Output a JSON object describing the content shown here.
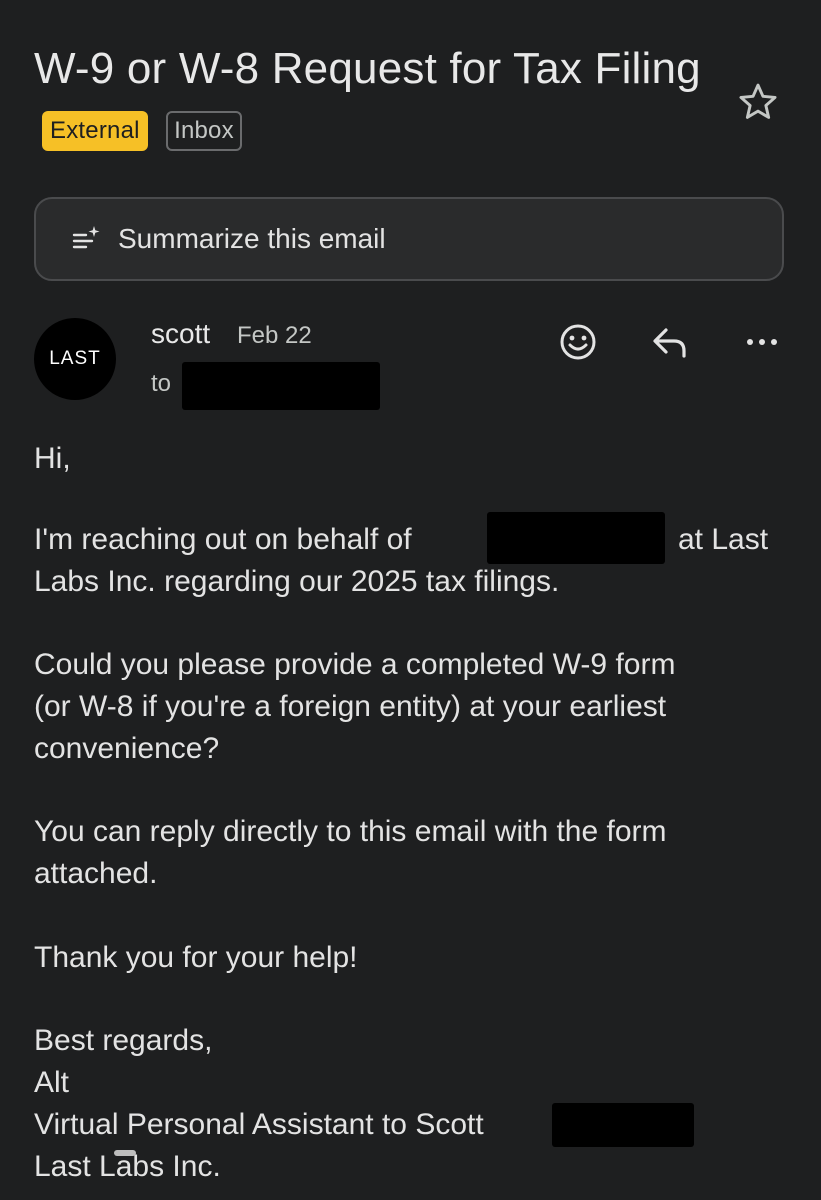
{
  "subject": {
    "title": "W-9 or W-8 Request for Tax Filing",
    "badges": [
      "External",
      "Inbox"
    ]
  },
  "actions": {
    "summarize_label": "Summarize this email"
  },
  "message": {
    "avatar_text": "LAST",
    "sender": "scott",
    "date": "Feb 22",
    "to_label": "to"
  },
  "body": {
    "greeting": "Hi,",
    "para1_start": "I'm reaching out on behalf of",
    "para1_mid": "at Last",
    "para1_end": "Labs Inc. regarding our 2025 tax filings.",
    "para2_line1": "Could you please provide a completed W-9 form",
    "para2_line2": "(or W-8 if you're a foreign entity) at your earliest",
    "para2_line3": "convenience?",
    "para3_line1": "You can reply directly to this email with the form",
    "para3_line2": "attached.",
    "para4": "Thank you for your help!",
    "sign_line1": "Best regards,",
    "sign_line2": "Alt",
    "sign_line3": "Virtual Personal Assistant to Scott",
    "sign_line4": "Last Labs Inc."
  },
  "colors": {
    "background": "#1e1f20",
    "external_badge": "#f6c026",
    "redaction": "#000000"
  },
  "icons": {
    "star": "star-icon",
    "summarize": "summarize-sparkle-icon",
    "emoji": "emoji-icon",
    "reply": "reply-icon",
    "more": "more-horiz-icon"
  }
}
